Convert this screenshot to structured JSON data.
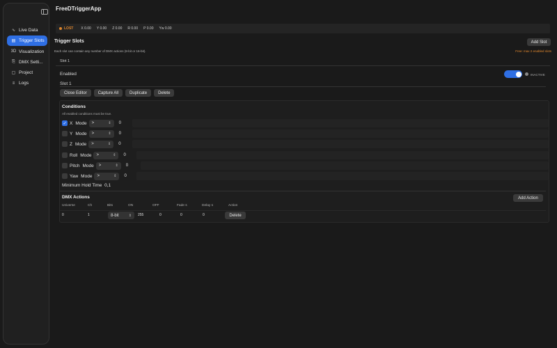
{
  "app": {
    "title": "FreeDTriggerApp"
  },
  "sidebar": {
    "items": [
      {
        "label": "Live Data",
        "icon": "pulse-icon",
        "glyph": "∿"
      },
      {
        "label": "Trigger Slots",
        "icon": "slots-icon",
        "glyph": "▤",
        "active": true
      },
      {
        "label": "Visualization",
        "icon": "3d-icon",
        "glyph": "3D"
      },
      {
        "label": "DMX Setti...",
        "icon": "dmx-icon",
        "glyph": "⎘"
      },
      {
        "label": "Project",
        "icon": "folder-icon",
        "glyph": "▢"
      },
      {
        "label": "Logs",
        "icon": "document-icon",
        "glyph": "≡"
      }
    ]
  },
  "status": {
    "state": "LOST",
    "state_color": "#e0872d",
    "coords": [
      {
        "label": "X",
        "value": "0.00"
      },
      {
        "label": "Y",
        "value": "0.00"
      },
      {
        "label": "Z",
        "value": "0.00"
      },
      {
        "label": "R",
        "value": "0.00"
      },
      {
        "label": "P",
        "value": "0.00"
      },
      {
        "label": "Yw",
        "value": "0.00"
      }
    ]
  },
  "trigger": {
    "title": "Trigger Slots",
    "subtitle": "Each slot can contain any number of DMX actions (8-bit or 16-bit).",
    "add_slot": "Add Slot",
    "free_note": "Free: max 2 enabled slots",
    "slot_tab": "Slot 1",
    "enabled_label": "Enabled",
    "enabled": true,
    "inactive_label": "INACTIVE",
    "slot_name": "Slot 1",
    "buttons": [
      "Close Editor",
      "Capture All",
      "Duplicate",
      "Delete"
    ]
  },
  "conditions": {
    "title": "Conditions",
    "subtitle": "All enabled conditions must be true.",
    "mode_label": "Mode",
    "rows": [
      {
        "axis": "X",
        "checked": true,
        "op": ">",
        "value": "0"
      },
      {
        "axis": "Y",
        "checked": false,
        "op": ">",
        "value": "0"
      },
      {
        "axis": "Z",
        "checked": false,
        "op": ">",
        "value": "0"
      },
      {
        "axis": "Roll",
        "checked": false,
        "op": ">",
        "value": "0"
      },
      {
        "axis": "Pitch",
        "checked": false,
        "op": ">",
        "value": "0"
      },
      {
        "axis": "Yaw",
        "checked": false,
        "op": ">",
        "value": "0"
      }
    ],
    "hold_label": "Minimum Hold Time",
    "hold_value": "0,1"
  },
  "dmx": {
    "title": "DMX Actions",
    "add_action": "Add Action",
    "headers": [
      "Universe",
      "Ch",
      "Bits",
      "ON",
      "OFF",
      "Fade s",
      "Delay s",
      "Action"
    ],
    "row": {
      "universe": "0",
      "ch": "1",
      "bits": "8-bit",
      "on": "255",
      "off": "0",
      "fade": "0",
      "delay": "0",
      "action": "Delete"
    }
  },
  "colors": {
    "accent": "#2f6fe4",
    "warning": "#e0872d"
  }
}
